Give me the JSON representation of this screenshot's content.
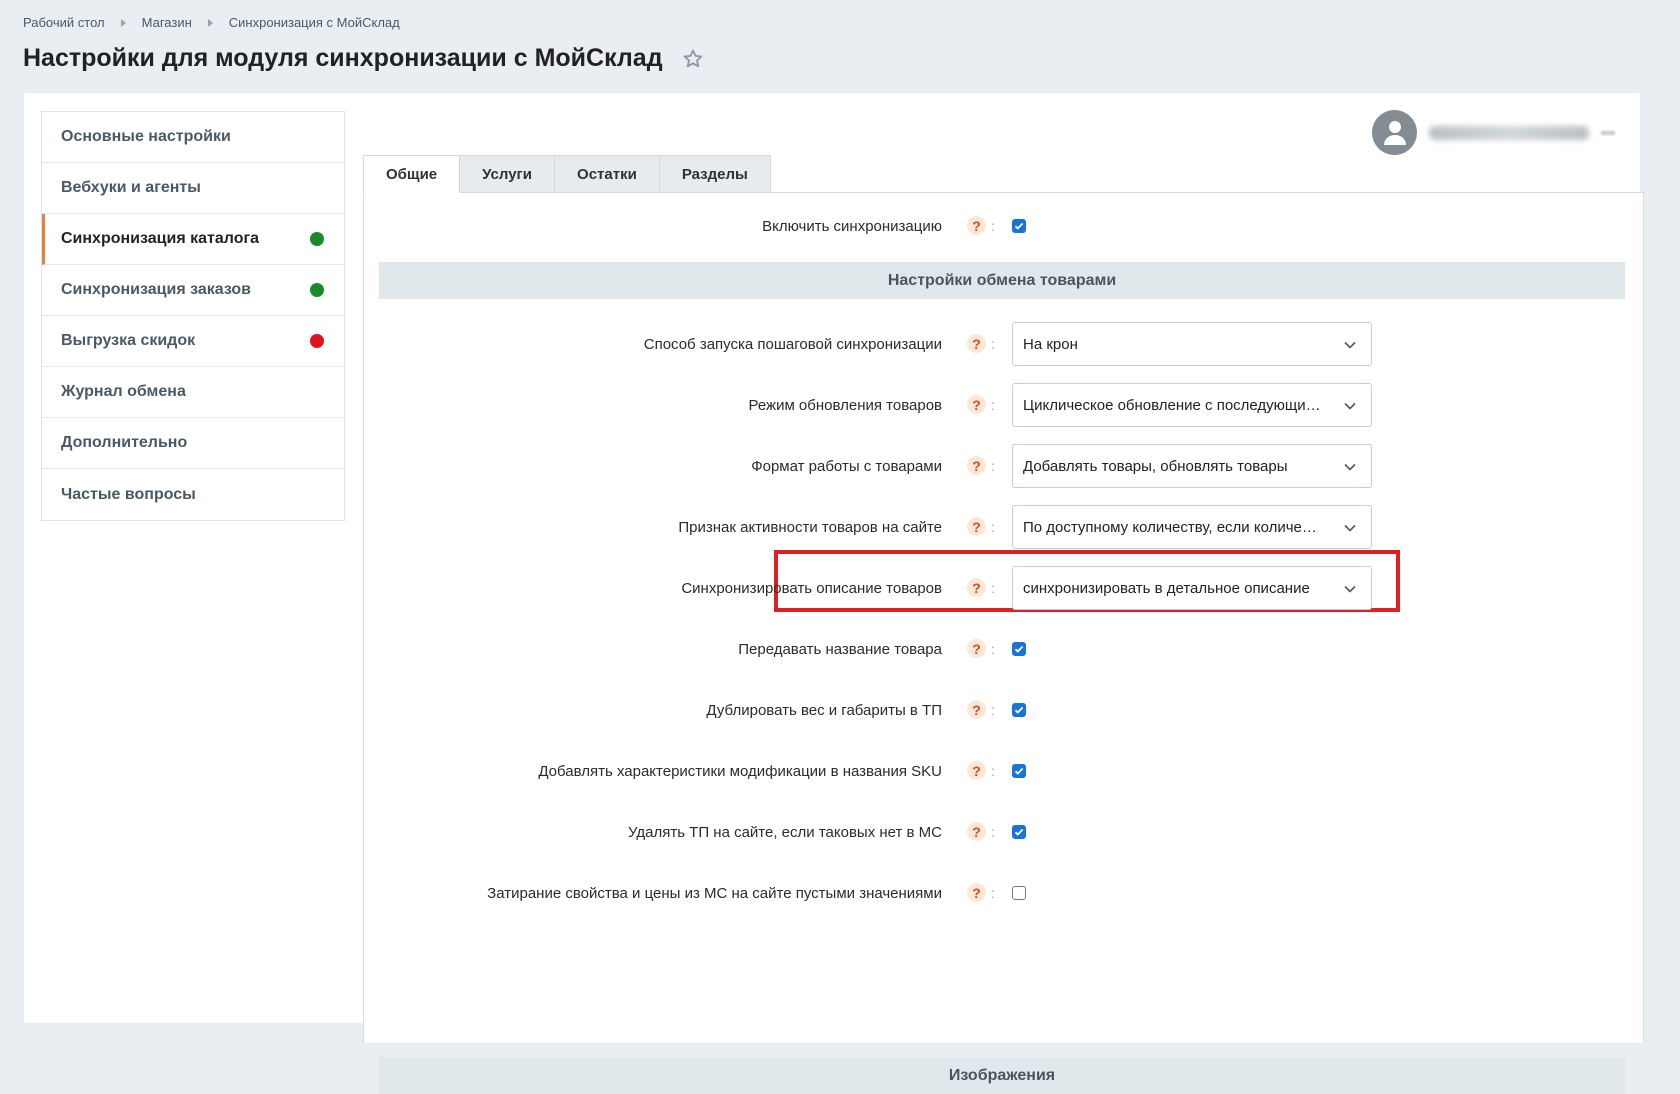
{
  "breadcrumb": [
    "Рабочий стол",
    "Магазин",
    "Синхронизация с МойСклад"
  ],
  "page_title": "Настройки для модуля синхронизации с МойСклад",
  "sidebar": {
    "items": [
      {
        "label": "Основные настройки"
      },
      {
        "label": "Вебхуки и агенты"
      },
      {
        "label": "Синхронизация каталога",
        "active": true,
        "status": "green",
        "status_color": "#1a8a2a"
      },
      {
        "label": "Синхронизация заказов",
        "status": "green",
        "status_color": "#1a8a2a"
      },
      {
        "label": "Выгрузка скидок",
        "status": "red",
        "status_color": "#e0141c"
      },
      {
        "label": "Журнал обмена"
      },
      {
        "label": "Дополнительно"
      },
      {
        "label": "Частые вопросы"
      }
    ]
  },
  "tabs": [
    {
      "label": "Общие",
      "active": true
    },
    {
      "label": "Услуги"
    },
    {
      "label": "Остатки"
    },
    {
      "label": "Разделы"
    }
  ],
  "form": {
    "enable_sync": {
      "label": "Включить синхронизацию",
      "checked": true
    },
    "section_exchange": "Настройки обмена товарами",
    "launch_method": {
      "label": "Способ запуска пошаговой синхронизации",
      "value": "На крон"
    },
    "update_mode": {
      "label": "Режим обновления товаров",
      "value": "Циклическое обновление с последующим пропуском"
    },
    "work_format": {
      "label": "Формат работы с товарами",
      "value": "Добавлять товары, обновлять товары"
    },
    "activity_sign": {
      "label": "Признак активности товаров на сайте",
      "value": "По доступному количеству, если количество больше нуля"
    },
    "sync_description": {
      "label": "Синхронизировать описание товаров",
      "value": "синхронизировать в детальное описание"
    },
    "pass_name": {
      "label": "Передавать название товара",
      "checked": true
    },
    "duplicate_weight": {
      "label": "Дублировать вес и габариты в ТП",
      "checked": true
    },
    "add_sku_props": {
      "label": "Добавлять характеристики модификации в названия SKU",
      "checked": true
    },
    "delete_tp": {
      "label": "Удалять ТП на сайте, если таковых нет в МС",
      "checked": true
    },
    "overwrite_empty": {
      "label": "Затирание свойства и цены из МС на сайте пустыми значениями",
      "checked": false
    },
    "section_images": "Изображения",
    "help_glyph": "?",
    "colon_glyph": ":"
  },
  "colors": {
    "accent": "#e57f3a",
    "checkbox": "#1a73d9",
    "highlight": "#e02020",
    "help": "#d94a1a"
  },
  "icons": {
    "star": "star-icon",
    "user": "user-icon",
    "chevron": "chevron-down-icon",
    "check": "check-icon"
  }
}
